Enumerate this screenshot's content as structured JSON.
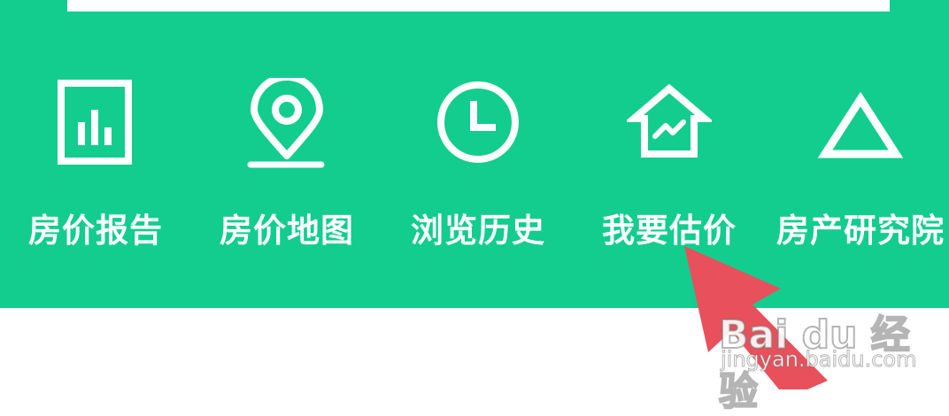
{
  "nav": {
    "items": [
      {
        "label": "房价报告",
        "icon": "report-chart-icon"
      },
      {
        "label": "房价地图",
        "icon": "map-pin-icon"
      },
      {
        "label": "浏览历史",
        "icon": "clock-icon"
      },
      {
        "label": "我要估价",
        "icon": "house-trend-icon"
      },
      {
        "label": "房产研究院",
        "icon": "triangle-icon"
      }
    ]
  },
  "watermark": {
    "logo": "Bai du 经验",
    "url": "jingyan.baidu.com"
  },
  "colors": {
    "panel": "#12cd8e",
    "arrow": "#e8505b",
    "text": "#ffffff"
  }
}
